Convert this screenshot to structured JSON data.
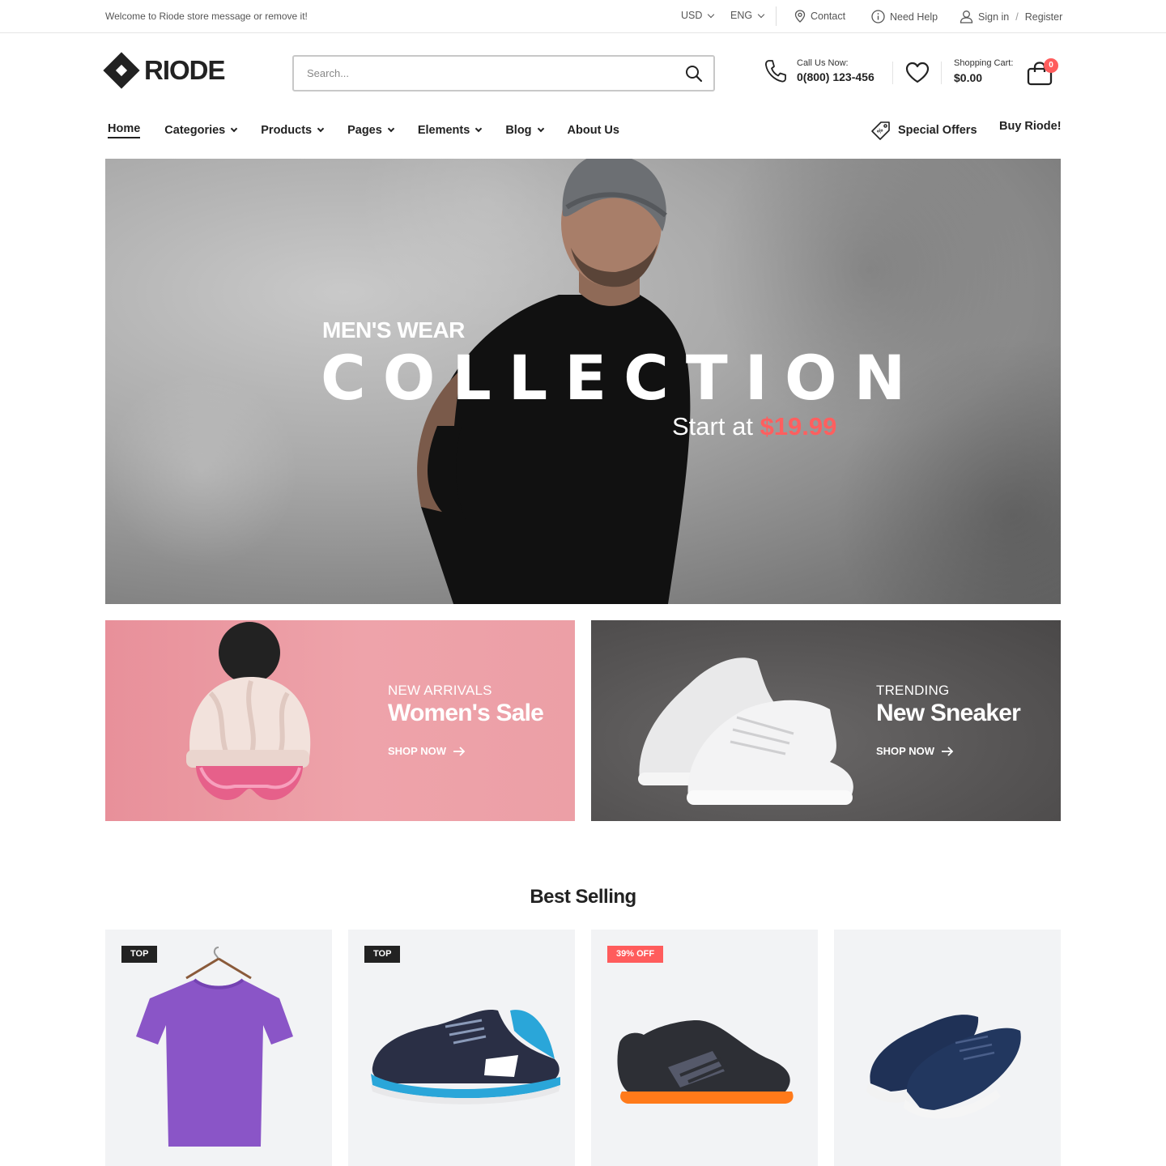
{
  "topbar": {
    "welcome": "Welcome to Riode store message or remove it!",
    "currency": "USD",
    "language": "ENG",
    "contact": "Contact",
    "need_help": "Need Help",
    "sign_in": "Sign in",
    "separator": "/",
    "register": "Register"
  },
  "header": {
    "logo_text": "RIODE",
    "search_placeholder": "Search...",
    "call_label": "Call Us Now:",
    "call_number": "0(800) 123-456",
    "cart_label": "Shopping Cart:",
    "cart_total": "$0.00",
    "cart_count": "0"
  },
  "nav": {
    "items": [
      {
        "label": "Home"
      },
      {
        "label": "Categories"
      },
      {
        "label": "Products"
      },
      {
        "label": "Pages"
      },
      {
        "label": "Elements"
      },
      {
        "label": "Blog"
      },
      {
        "label": "About Us"
      }
    ],
    "special_offers": "Special Offers",
    "buy": "Buy Riode!"
  },
  "hero": {
    "subtitle": "MEN'S WEAR",
    "title": "COLLECTION",
    "price_prefix": "Start at",
    "price": "$19.99"
  },
  "banners": [
    {
      "label": "NEW ARRIVALS",
      "title": "Women's Sale",
      "cta": "SHOP NOW"
    },
    {
      "label": "TRENDING",
      "title": "New Sneaker",
      "cta": "SHOP NOW"
    }
  ],
  "best_selling": {
    "title": "Best Selling",
    "products": [
      {
        "badge": "TOP",
        "image": "purple t-shirt"
      },
      {
        "badge": "TOP",
        "image": "navy blue running shoe"
      },
      {
        "badge": "39% OFF",
        "image": "black hiking shoe"
      },
      {
        "badge": "",
        "image": "navy suede sneakers"
      }
    ]
  },
  "colors": {
    "accent_red": "#ff5c5c",
    "text_dark": "#222222",
    "pink_banner": "#eea3aa",
    "dark_banner": "#565454"
  }
}
